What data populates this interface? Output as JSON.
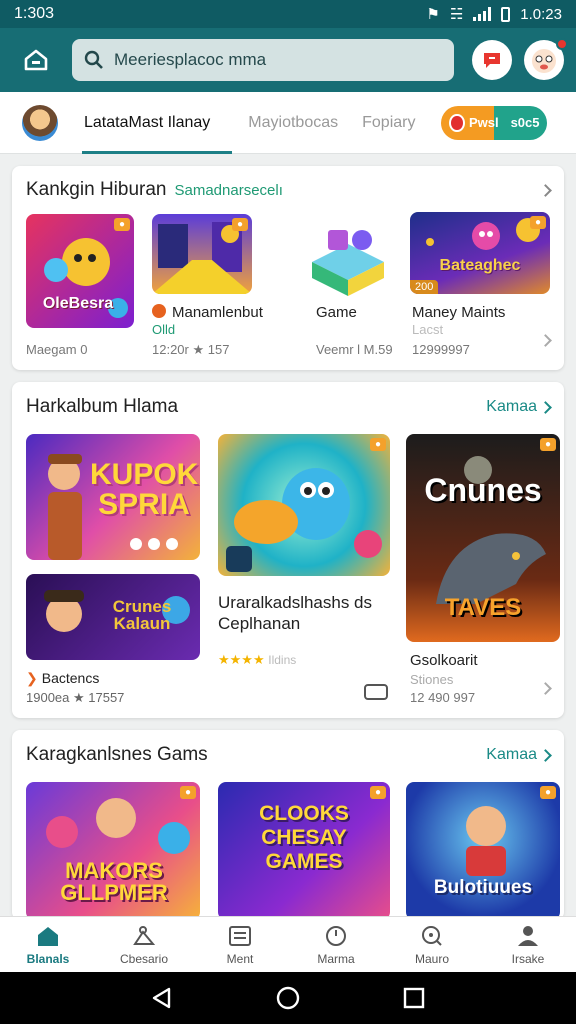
{
  "status": {
    "time": "1:303",
    "clock": "1.0:23"
  },
  "header": {
    "search_text": "Meeriesplacoc mma"
  },
  "tabs": {
    "items": [
      "LatataMast  Ilanay",
      "Mayiotbocas",
      "Fopiary"
    ],
    "pill_left": "Pwsl",
    "pill_right": "s0c5"
  },
  "section1": {
    "title": "Kankgin Hiburan",
    "subtitle": "Samadnarsecelı",
    "items": [
      {
        "art": "OleBesra",
        "caption": "",
        "meta": "Maegam  0"
      },
      {
        "art": "",
        "caption": "Manamlenbut",
        "caption2": "Olld",
        "meta": "12:20r ★ 157"
      },
      {
        "art": "",
        "caption": "Game",
        "meta": "Veemr l M.59"
      },
      {
        "art": "Bateaghec",
        "badge": "200",
        "caption": "Maney Maints",
        "caption2": "Lacst",
        "meta": "12999997"
      }
    ]
  },
  "section2": {
    "title": "Harkalbum Hlama",
    "more": "Kamaa",
    "items": [
      {
        "art": "KUPOK SPRIA"
      },
      {
        "art": "Crunes Kalaun"
      },
      {
        "caption": "Bactencs",
        "meta": "1900ea ★ 17557"
      },
      {
        "caption": "Uraralkadslhashs ds Ceplhanan",
        "rating": "★★★★",
        "meta": "Ildins"
      },
      {
        "art": "Cnunes",
        "art2": "TAVES",
        "caption": "Gsolkoarit",
        "caption2": "Stiones",
        "meta": "12 490 997"
      }
    ]
  },
  "section3": {
    "title": "Karagkanlsnes Gams",
    "more": "Kamaa",
    "items": [
      {
        "art": "MAKORS GLLPMER"
      },
      {
        "art": "CLOOKS CHESAY GAMES"
      },
      {
        "art": "Bulotiuues"
      }
    ]
  },
  "bottom_nav": [
    "Blanals",
    "Cbesario",
    "Ment",
    "Marma",
    "Mauro",
    "Irsake"
  ]
}
